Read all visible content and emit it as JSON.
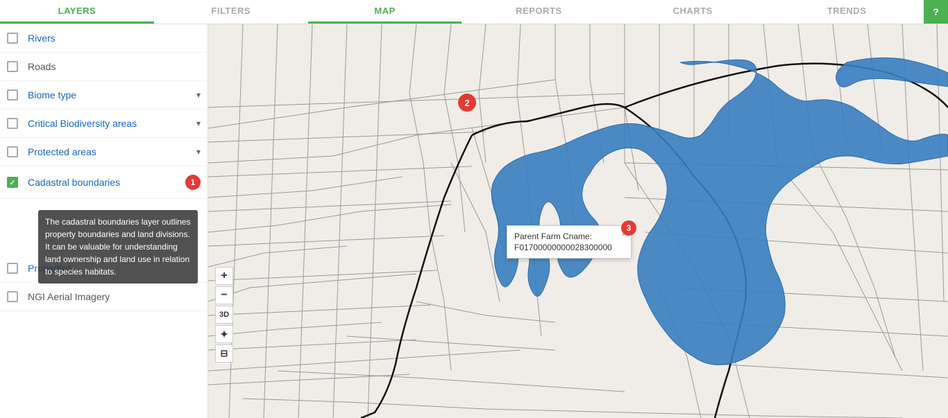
{
  "nav": {
    "items": [
      {
        "label": "LAYERS",
        "active": true
      },
      {
        "label": "FILTERS",
        "active": false
      },
      {
        "label": "MAP",
        "active": true,
        "underline": true
      },
      {
        "label": "REPORTS",
        "active": false
      },
      {
        "label": "CHARTS",
        "active": false
      },
      {
        "label": "TRENDS",
        "active": false
      }
    ],
    "help_label": "?"
  },
  "sidebar": {
    "layers": [
      {
        "id": "rivers",
        "label": "Rivers",
        "checked": false,
        "link": true,
        "has_chevron": false,
        "badge": null
      },
      {
        "id": "roads",
        "label": "Roads",
        "checked": false,
        "link": false,
        "has_chevron": false,
        "badge": null
      },
      {
        "id": "biome-type",
        "label": "Biome type",
        "checked": false,
        "link": true,
        "has_chevron": true,
        "badge": null
      },
      {
        "id": "critical-biodiversity",
        "label": "Critical Biodiversity areas",
        "checked": false,
        "link": true,
        "has_chevron": true,
        "badge": null
      },
      {
        "id": "protected-areas",
        "label": "Protected areas",
        "checked": false,
        "link": true,
        "has_chevron": true,
        "badge": null
      },
      {
        "id": "cadastral-boundaries",
        "label": "Cadastral boundaries",
        "checked": true,
        "link": true,
        "has_chevron": false,
        "badge": "1"
      },
      {
        "id": "properties",
        "label": "Properties",
        "checked": false,
        "link": true,
        "has_chevron": false,
        "badge": null
      },
      {
        "id": "ngi-aerial",
        "label": "NGI Aerial Imagery",
        "checked": false,
        "link": false,
        "has_chevron": false,
        "badge": null
      }
    ],
    "tooltip": "The cadastral boundaries layer outlines property boundaries and land divisions. It can be valuable for understanding land ownership and land use in relation to species habitats."
  },
  "map": {
    "badge2_label": "2",
    "badge3_label": "3",
    "popup_title": "Parent Farm Cname:",
    "popup_value": "F01700000000028300000",
    "popup_close": "×",
    "controls": {
      "zoom_in": "+",
      "zoom_out": "−",
      "threed": "3D",
      "sun": "✦",
      "print": "⊟"
    }
  }
}
